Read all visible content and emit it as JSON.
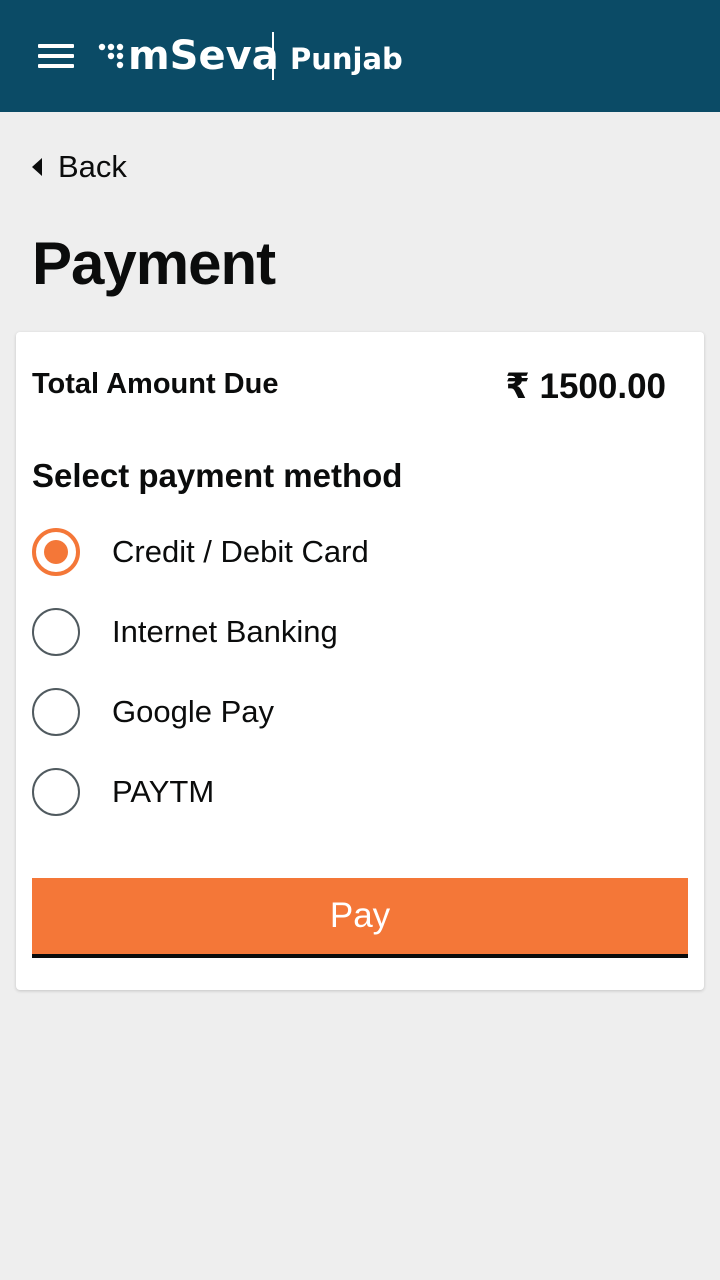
{
  "header": {
    "brand": "mSeva",
    "city": "Punjab",
    "background_color": "#0b4b66"
  },
  "nav": {
    "back_label": "Back"
  },
  "page": {
    "title": "Payment"
  },
  "payment": {
    "total_label": "Total Amount Due",
    "total_value": "₹ 1500.00",
    "method_heading": "Select payment method",
    "options": [
      {
        "label": "Credit / Debit Card",
        "selected": true
      },
      {
        "label": "Internet Banking",
        "selected": false
      },
      {
        "label": "Google Pay",
        "selected": false
      },
      {
        "label": "PAYTM",
        "selected": false
      }
    ],
    "pay_label": "Pay",
    "accent_color": "#f47738"
  },
  "icons": {
    "menu": "hamburger-menu-icon",
    "back": "caret-left-icon",
    "logo": "mseva-logo-dots-icon"
  }
}
